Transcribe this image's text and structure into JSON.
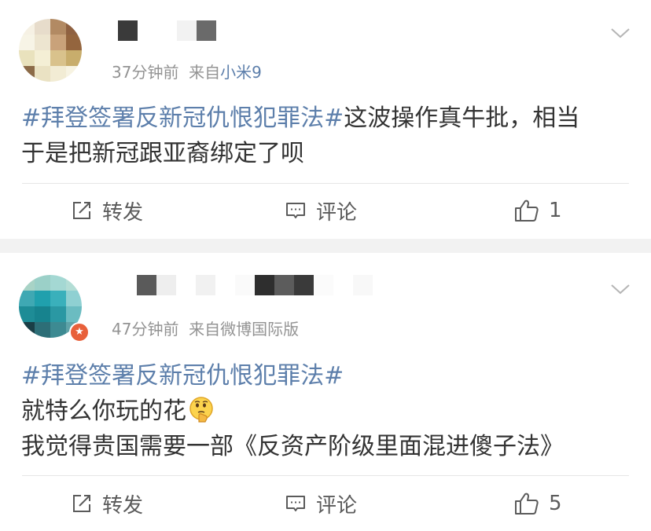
{
  "posts": [
    {
      "meta": {
        "time": "37分钟前",
        "from_label": "来自",
        "source": "小米9"
      },
      "content": {
        "hashtag": "#拜登签署反新冠仇恨犯罪法#",
        "line1_rest": "这波操作真牛批，相当",
        "line2": "于是把新冠跟亚裔绑定了呗"
      },
      "actions": {
        "repost": "转发",
        "comment": "评论",
        "like_count": "1"
      }
    },
    {
      "meta": {
        "time": "47分钟前",
        "from_label": "来自",
        "source": "微博国际版"
      },
      "content": {
        "hashtag": "#拜登签署反新冠仇恨犯罪法#",
        "line2": "就特么你玩的花",
        "line3": "我觉得贵国需要一部《反资产阶级里面混进傻子法》"
      },
      "actions": {
        "repost": "转发",
        "comment": "评论",
        "like_count": "5"
      }
    }
  ],
  "icons": {
    "repost": "repost-icon",
    "comment": "comment-icon",
    "like": "thumbs-up-icon",
    "menu": "chevron-down-icon",
    "emoji": "thinking-face-emoji"
  },
  "colors": {
    "link": "#5d7fab",
    "text": "#333333",
    "meta": "#939393",
    "action": "#5b5b5b",
    "separator": "#f2f2f2",
    "badge": "#e8603a"
  }
}
